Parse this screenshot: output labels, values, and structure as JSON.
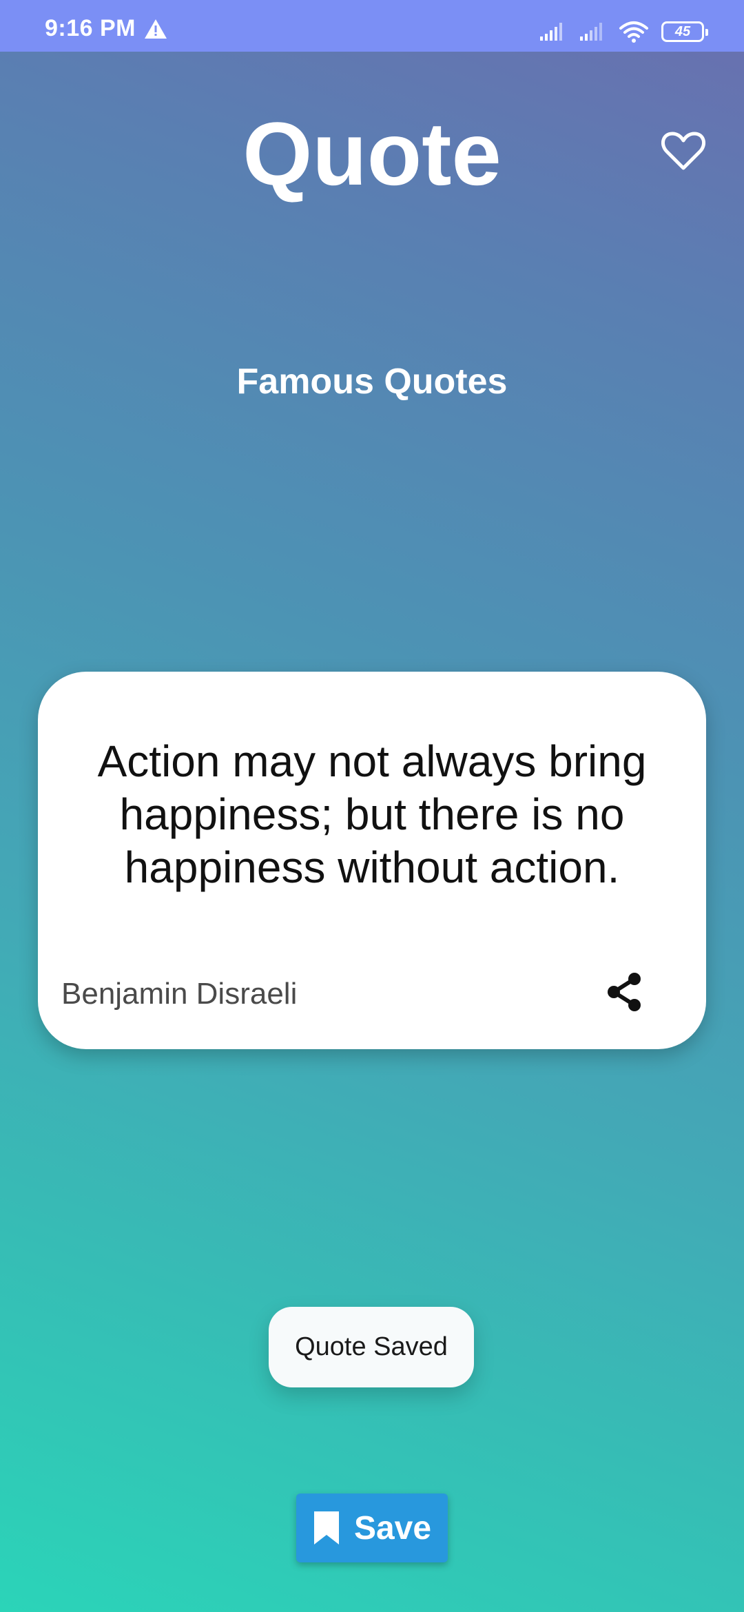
{
  "status_bar": {
    "time": "9:16 PM",
    "warning_icon": "warning-triangle-icon",
    "battery": "45",
    "icons": [
      "signal-icon",
      "signal-icon",
      "wifi-icon",
      "battery-icon"
    ]
  },
  "header": {
    "title": "Quote",
    "favorite_icon": "heart-outline-icon"
  },
  "subtitle": "Famous Quotes",
  "quote_card": {
    "text": "Action may not always bring happiness; but there is no happiness without action.",
    "author": "Benjamin Disraeli",
    "share_icon": "share-icon"
  },
  "toast": {
    "message": "Quote Saved"
  },
  "save_button": {
    "label": "Save",
    "icon": "bookmark-icon"
  },
  "colors": {
    "status_bar": "#7b8ff5",
    "gradient_top": "#6a6fb0",
    "gradient_bottom": "#2bd4b8",
    "save_button": "#2898dd",
    "card": "#ffffff"
  }
}
